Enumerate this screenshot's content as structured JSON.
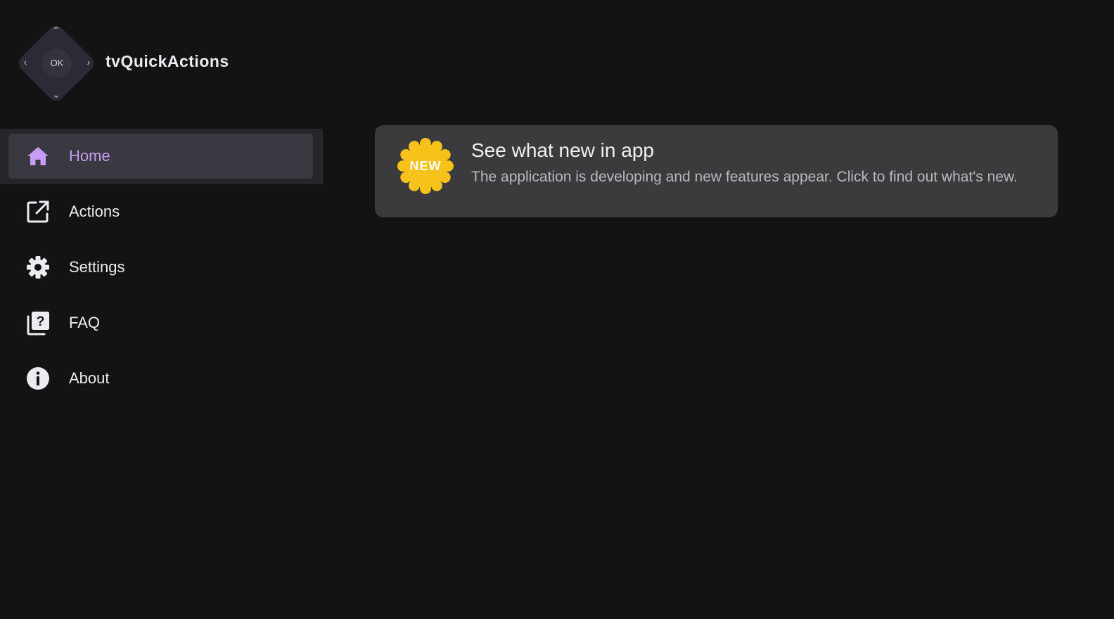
{
  "app": {
    "title": "tvQuickActions",
    "logo": {
      "center_label": "OK",
      "arrows": {
        "up": "⌃",
        "down": "⌄",
        "left": "‹",
        "right": "›"
      }
    }
  },
  "sidebar": {
    "accent_color": "#c79cf7",
    "items": [
      {
        "label": "Home",
        "icon": "home-icon",
        "active": true
      },
      {
        "label": "Actions",
        "icon": "open-external-icon",
        "active": false
      },
      {
        "label": "Settings",
        "icon": "gear-icon",
        "active": false
      },
      {
        "label": "FAQ",
        "icon": "question-library-icon",
        "active": false
      },
      {
        "label": "About",
        "icon": "info-icon",
        "active": false
      }
    ]
  },
  "main": {
    "news_card": {
      "badge": "NEW",
      "badge_color": "#f7c21a",
      "title": "See what new in app",
      "description": "The application is developing and new features appear. Click to find out what's new."
    }
  }
}
